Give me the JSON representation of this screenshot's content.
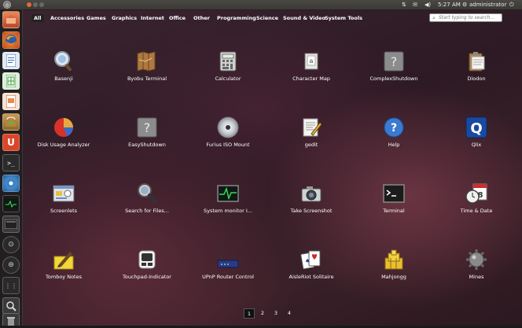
{
  "top_panel": {
    "user": "administrator",
    "time": "5:27 AM",
    "ubuntu_glyph": "◎"
  },
  "categories": [
    "All",
    "Accessories",
    "Games",
    "Graphics",
    "Internet",
    "Office",
    "Other",
    "Programming",
    "Science",
    "Sound & Video",
    "System Tools"
  ],
  "search": {
    "placeholder": "Start typing to search..."
  },
  "apps": [
    {
      "name": "Basenji",
      "icon": "magnifier-icon"
    },
    {
      "name": "Byobu Terminal",
      "icon": "map-icon"
    },
    {
      "name": "Calculator",
      "icon": "calculator-icon"
    },
    {
      "name": "Character Map",
      "icon": "character-map-icon"
    },
    {
      "name": "ComplexShutdown",
      "icon": "question-icon"
    },
    {
      "name": "Diodon",
      "icon": "clipboard-icon"
    },
    {
      "name": "Disk Usage Analyzer",
      "icon": "pie-chart-icon"
    },
    {
      "name": "EasyShutdown",
      "icon": "question-icon"
    },
    {
      "name": "Furius ISO Mount",
      "icon": "disc-icon"
    },
    {
      "name": "gedit",
      "icon": "text-editor-icon"
    },
    {
      "name": "Help",
      "icon": "help-icon"
    },
    {
      "name": "Qlix",
      "icon": "qlix-icon"
    },
    {
      "name": "Screenlets",
      "icon": "screenlets-icon"
    },
    {
      "name": "Search for Files...",
      "icon": "search-files-icon"
    },
    {
      "name": "System monitor I...",
      "icon": "system-monitor-icon"
    },
    {
      "name": "Take Screenshot",
      "icon": "camera-icon"
    },
    {
      "name": "Terminal",
      "icon": "terminal-icon"
    },
    {
      "name": "Time & Date",
      "icon": "clock-calendar-icon"
    },
    {
      "name": "Tomboy Notes",
      "icon": "notes-icon"
    },
    {
      "name": "Touchpad-Indicator",
      "icon": "touchpad-icon"
    },
    {
      "name": "UPnP Router Control",
      "icon": "router-icon"
    },
    {
      "name": "AisleRiot Solitaire",
      "icon": "cards-icon"
    },
    {
      "name": "Mahjongg",
      "icon": "mahjongg-icon"
    },
    {
      "name": "Mines",
      "icon": "mine-icon"
    }
  ],
  "pages": [
    "1",
    "2",
    "3",
    "4"
  ],
  "calendar_day": "8",
  "charmap_glyph": "a",
  "qlix_glyph": "Q"
}
